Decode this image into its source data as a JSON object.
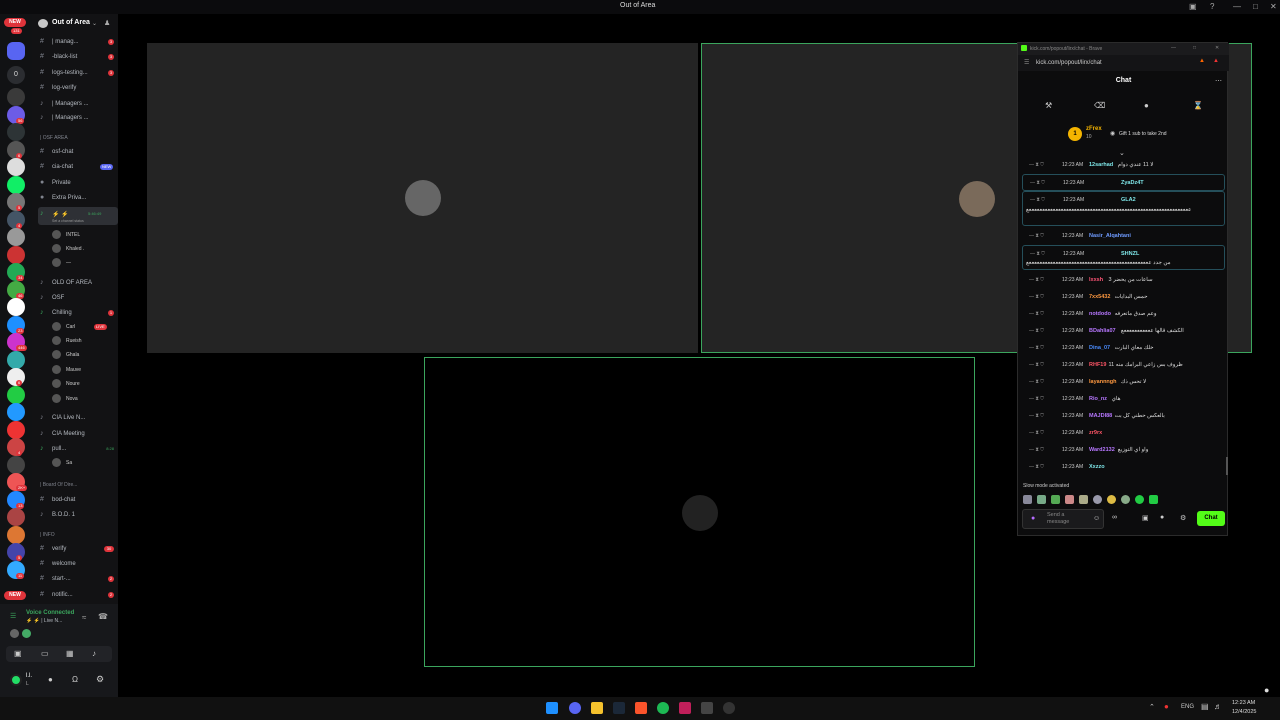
{
  "window": {
    "title": "Out of Area"
  },
  "rail": {
    "new_top": "NEW",
    "badge_top": "131",
    "dm_badge": "0",
    "new_bottom": "NEW",
    "badges": [
      "",
      "56",
      "",
      "6",
      "",
      "",
      "5",
      "4",
      "",
      "",
      "34",
      "46",
      "",
      "23",
      "446",
      "",
      "6",
      "",
      "",
      "",
      "4",
      "",
      "2K+",
      "13",
      "",
      "",
      "5",
      "11"
    ]
  },
  "server": {
    "name": "Out of Area"
  },
  "channels": [
    {
      "label": "| manag...",
      "count": "3",
      "type": "text"
    },
    {
      "label": "-black-list",
      "count": "3",
      "type": "text"
    },
    {
      "label": "logs-testing...",
      "count": "3",
      "type": "text"
    },
    {
      "label": "log-verify",
      "count": "",
      "type": "text"
    },
    {
      "label": "| Managers ...",
      "count": "",
      "type": "voice"
    },
    {
      "label": "| Managers ...",
      "count": "",
      "type": "voice"
    }
  ],
  "osf": {
    "category": "| OSF AREA",
    "items": [
      "osf-chat",
      "cia-chat",
      "Private",
      "Extra Priva...",
      "⚡ ⚡",
      "INTEL",
      "Khaled .",
      "—",
      "OLD OF AREA",
      "OSF",
      "Chilling"
    ],
    "new_badge": "NEW",
    "status": "Set a channel status",
    "timer": "5:46:49"
  },
  "chilling_users": [
    "Carl",
    "Rueish",
    "Ghala",
    "Mauve",
    "Noure",
    "Nova"
  ],
  "live_badge": "LIVE",
  "more_channels": [
    "CIA Live N...",
    "CIA Meeting",
    "pull...",
    "Sa"
  ],
  "pull_timer": "8:28",
  "board": {
    "category": "| Board Of Dire...",
    "items": [
      "bod-chat",
      "B.O.D. 1"
    ]
  },
  "info": {
    "category": "| INFO",
    "items": [
      {
        "label": "verify",
        "count": "30"
      },
      {
        "label": "welcome",
        "count": ""
      },
      {
        "label": "start-...",
        "count": "2"
      },
      {
        "label": "notific...",
        "count": "2"
      }
    ]
  },
  "voice": {
    "status": "Voice Connected",
    "channel": "⚡ ⚡ | Live N...",
    "user": "l.l.",
    "user_status": "L"
  },
  "chat": {
    "window_title": "kick.com/popout/lirx/chat - Brave",
    "url": "kick.com/popout/lirx/chat",
    "header": "Chat",
    "pinned_user": "zFrex",
    "pinned_count": "10",
    "pinned_rank": "1",
    "gift_text": "Gift 1 sub to take 2nd",
    "slow_mode": "Slow mode activated",
    "input_placeholder": "Send a message",
    "send_label": "Chat",
    "messages": [
      {
        "time": "12:23 AM",
        "user": "12sarhad",
        "color": "#7ee6e8",
        "text": "لا 11 عندي دوام",
        "hl": false
      },
      {
        "time": "12:23 AM",
        "user": "ZyaDz4T",
        "color": "#7ee6e8",
        "text": "",
        "hl": true
      },
      {
        "time": "12:23 AM",
        "user": "GLA2",
        "color": "#7ee6e8",
        "text": "عععععععععععععععععععععععععععععععععععععععععععععععععععععععععععععع",
        "hl": true
      },
      {
        "time": "12:23 AM",
        "user": "Nasir_Alqahtani",
        "color": "#6f9bff",
        "text": "",
        "hl": false
      },
      {
        "time": "12:23 AM",
        "user": "SHNZL",
        "color": "#7ee6e8",
        "text": "من جدد ععععععععععععععععععععععععععععععععععععععععععععععع",
        "hl": true
      },
      {
        "time": "12:23 AM",
        "user": "lxxsh",
        "color": "#ff5577",
        "text": "ساعات من يحضر 3",
        "hl": false
      },
      {
        "time": "12:23 AM",
        "user": "7xx5432",
        "color": "#ff9940",
        "text": "حمس البدايات",
        "hl": false
      },
      {
        "time": "12:23 AM",
        "user": "notdodo",
        "color": "#b777ff",
        "text": "وعم صدق ماتعرفه",
        "hl": false
      },
      {
        "time": "12:23 AM",
        "user": "BDahlia07",
        "color": "#b777ff",
        "text": "الكشف قالها عععععععععععع",
        "hl": false
      },
      {
        "time": "12:23 AM",
        "user": "Dina_07",
        "color": "#4a8cff",
        "text": "خلك معاي البارت",
        "hl": false
      },
      {
        "time": "12:23 AM",
        "user": "RHF19",
        "color": "#ff5566",
        "text": "ظروف بس زاعي البرامك منه 11",
        "hl": false
      },
      {
        "time": "12:23 AM",
        "user": "layannngh",
        "color": "#ff9940",
        "text": "لا تحس ذك",
        "hl": false
      },
      {
        "time": "12:23 AM",
        "user": "Rio_nz",
        "color": "#b777ff",
        "text": "هاي",
        "hl": false
      },
      {
        "time": "12:23 AM",
        "user": "MAJDI88",
        "color": "#b777ff",
        "text": "بالعكس حطني كل بت",
        "hl": false
      },
      {
        "time": "12:23 AM",
        "user": "zr9rx",
        "color": "#ff5566",
        "text": "",
        "hl": false
      },
      {
        "time": "12:23 AM",
        "user": "Ward2132",
        "color": "#b777ff",
        "text": "واو اي التوزيع",
        "hl": false
      },
      {
        "time": "12:23 AM",
        "user": "Xxzzo",
        "color": "#7ee6e8",
        "text": "",
        "hl": false
      }
    ]
  },
  "tray": {
    "lang": "ENG",
    "time": "12:23 AM",
    "date": "12/4/2025"
  }
}
